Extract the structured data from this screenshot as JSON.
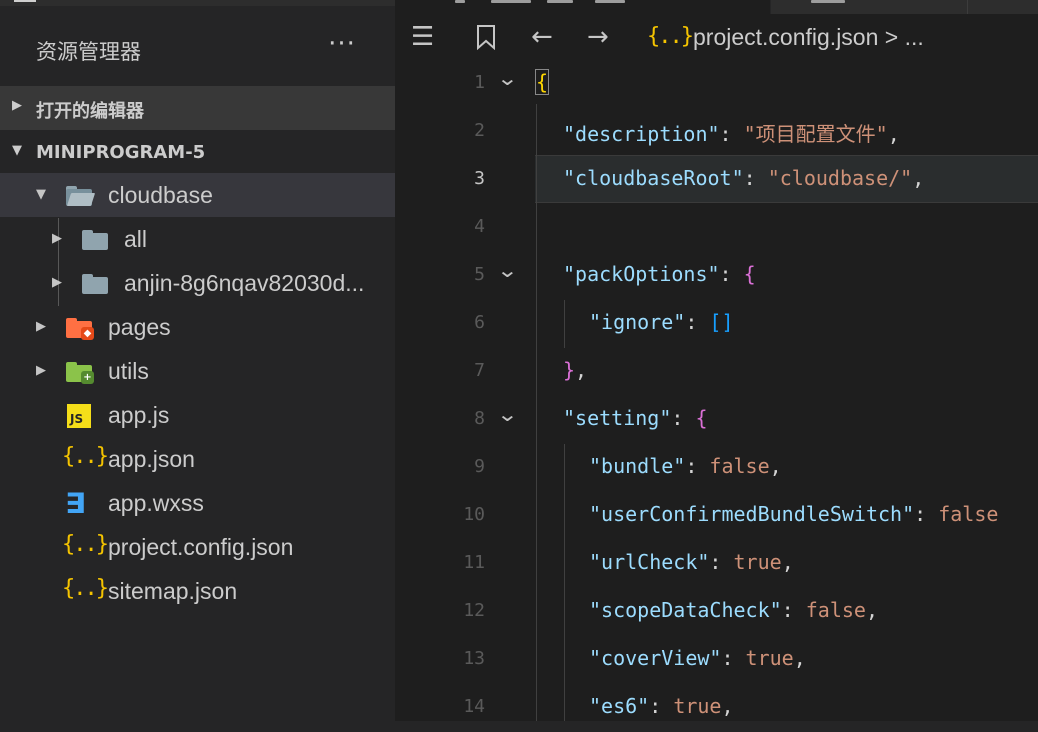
{
  "sidebar": {
    "title": "资源管理器",
    "more_label": "···",
    "open_editors_label": "打开的编辑器",
    "project_label": "MINIPROGRAM-5",
    "tree": {
      "cloudbase": "cloudbase",
      "all": "all",
      "anjin": "anjin-8g6nqav82030d...",
      "pages": "pages",
      "utils": "utils",
      "app_js": "app.js",
      "app_json": "app.json",
      "app_wxss": "app.wxss",
      "project_config": "project.config.json",
      "sitemap": "sitemap.json"
    },
    "icon_labels": {
      "js": "JS",
      "json": "{..}",
      "css": "∃"
    }
  },
  "editor": {
    "breadcrumb": {
      "json_icon": "{..}",
      "path": "project.config.json > ..."
    },
    "lines": [
      {
        "num": "1",
        "tokens": {
          "t1": "{"
        }
      },
      {
        "num": "2",
        "tokens": {
          "key": "\"description\"",
          "colon": ": ",
          "val": "\"项目配置文件\"",
          "end": ","
        }
      },
      {
        "num": "3",
        "tokens": {
          "key": "\"cloudbaseRoot\"",
          "colon": ": ",
          "val": "\"cloudbase/\"",
          "end": ","
        }
      },
      {
        "num": "4",
        "tokens": {}
      },
      {
        "num": "5",
        "tokens": {
          "key": "\"packOptions\"",
          "colon": ": ",
          "brace": "{"
        }
      },
      {
        "num": "6",
        "tokens": {
          "key": "\"ignore\"",
          "colon": ": ",
          "val": "[]"
        }
      },
      {
        "num": "7",
        "tokens": {
          "brace": "}",
          "end": ","
        }
      },
      {
        "num": "8",
        "tokens": {
          "key": "\"setting\"",
          "colon": ": ",
          "brace": "{"
        }
      },
      {
        "num": "9",
        "tokens": {
          "key": "\"bundle\"",
          "colon": ": ",
          "val": "false",
          "end": ","
        }
      },
      {
        "num": "10",
        "tokens": {
          "key": "\"userConfirmedBundleSwitch\"",
          "colon": ": ",
          "val": "false"
        }
      },
      {
        "num": "11",
        "tokens": {
          "key": "\"urlCheck\"",
          "colon": ": ",
          "val": "true",
          "end": ","
        }
      },
      {
        "num": "12",
        "tokens": {
          "key": "\"scopeDataCheck\"",
          "colon": ": ",
          "val": "false",
          "end": ","
        }
      },
      {
        "num": "13",
        "tokens": {
          "key": "\"coverView\"",
          "colon": ": ",
          "val": "true",
          "end": ","
        }
      },
      {
        "num": "14",
        "tokens": {
          "key": "\"es6\"",
          "colon": ": ",
          "val": "true",
          "end": ","
        }
      }
    ],
    "active_line": "3"
  },
  "colors": {
    "sidebar_bg": "#252526",
    "editor_bg": "#1e1e1e",
    "json_key": "#9cdcfe",
    "json_string": "#ce9178",
    "json_bool": "#ce9178",
    "bracket_gold": "#ffd700",
    "bracket_purple": "#da70d6",
    "bracket_blue": "#179fff"
  }
}
